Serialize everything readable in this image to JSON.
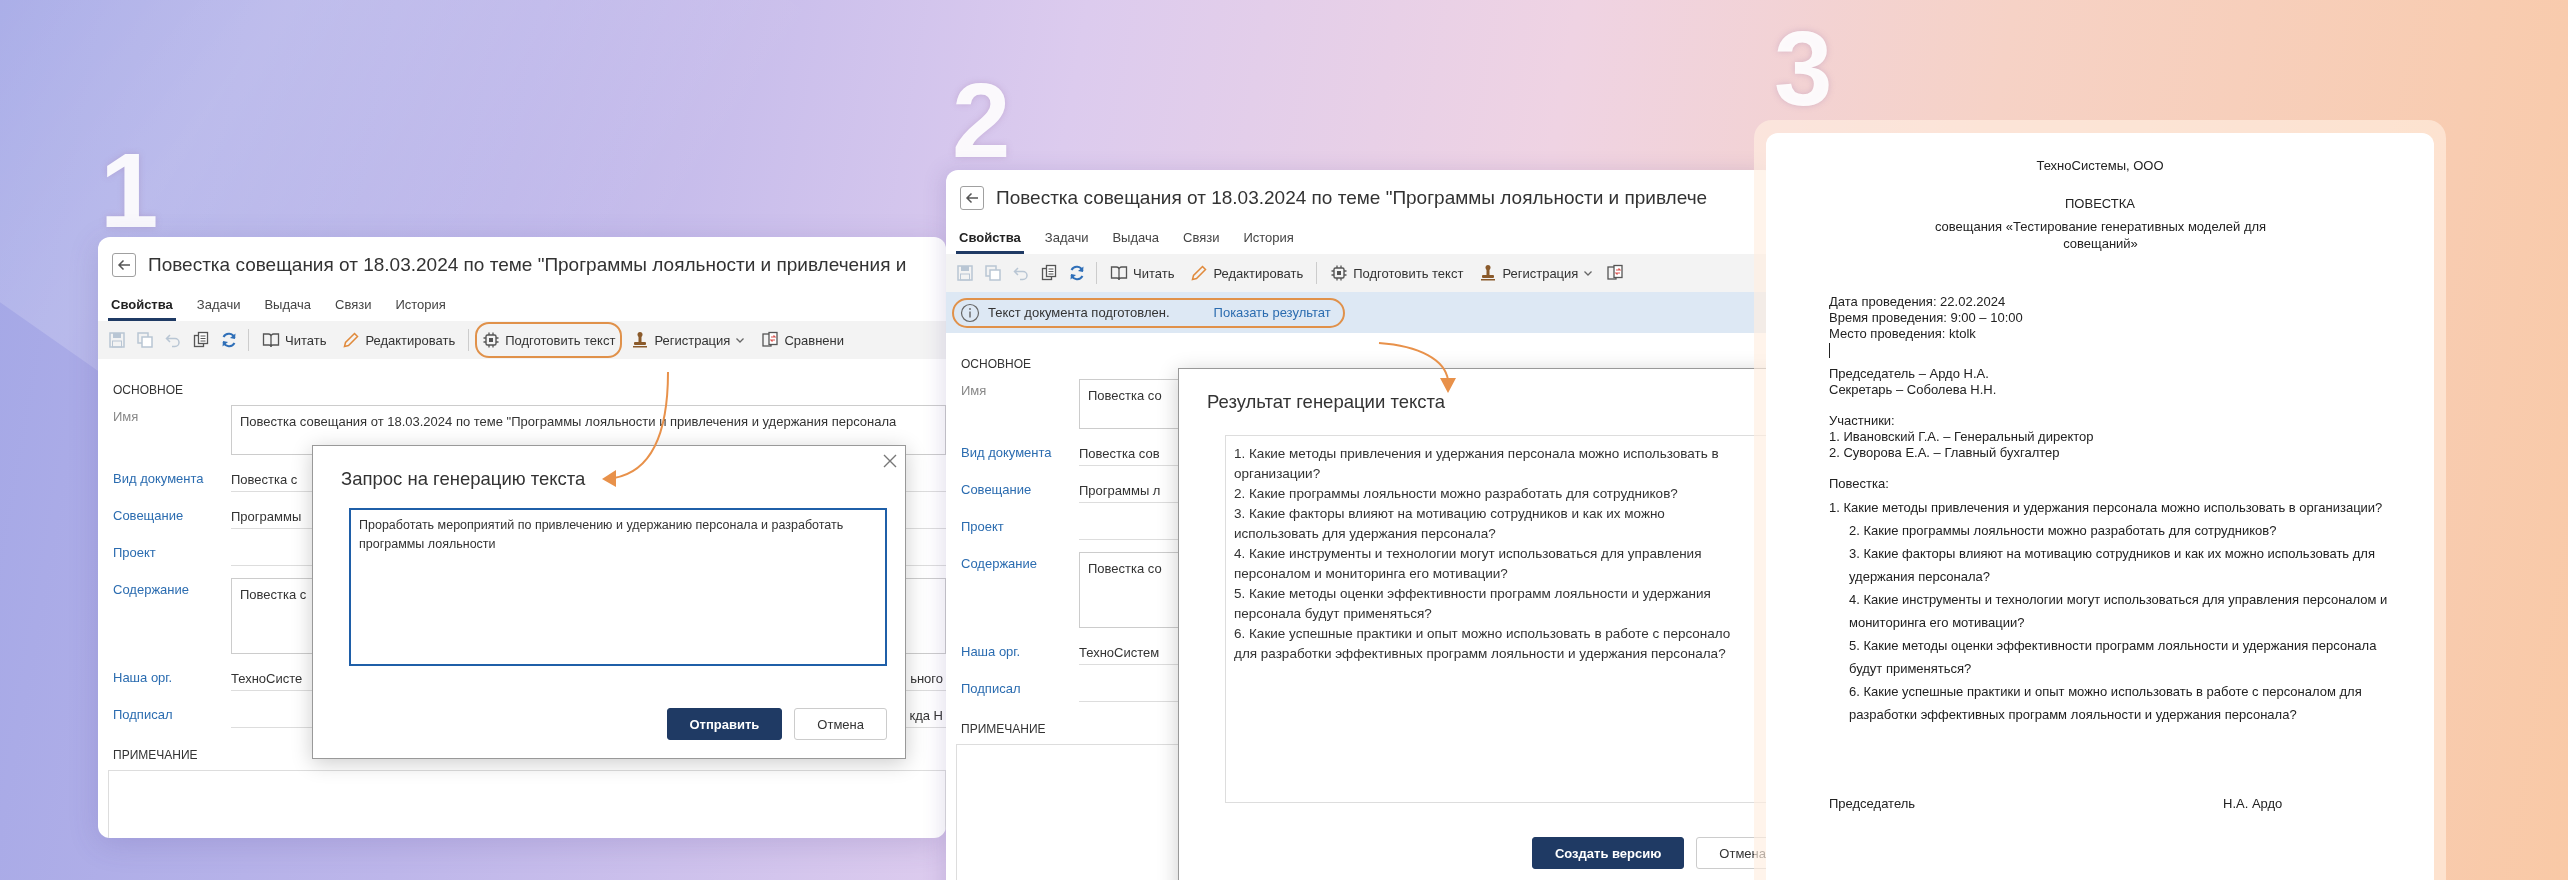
{
  "step_numbers": [
    "1",
    "2",
    "3"
  ],
  "panels": [
    {
      "title": "Повестка совещания от 18.03.2024 по теме \"Программы лояльности и привлечения и",
      "tabs": [
        {
          "label": "Свойства",
          "selected": true
        },
        {
          "label": "Задачи",
          "selected": false
        },
        {
          "label": "Выдача",
          "selected": false
        },
        {
          "label": "Связи",
          "selected": false
        },
        {
          "label": "История",
          "selected": false
        }
      ],
      "toolbar": [
        {
          "kind": "icon",
          "disabled": true
        },
        {
          "kind": "icon",
          "disabled": true
        },
        {
          "kind": "icon",
          "disabled": true
        },
        {
          "kind": "icon",
          "disabled": false
        },
        {
          "kind": "icon",
          "disabled": false
        },
        {
          "kind": "separator"
        },
        {
          "kind": "labeled",
          "label": "Читать",
          "highlighted": false
        },
        {
          "kind": "labeled",
          "label": "Редактировать",
          "highlighted": false
        },
        {
          "kind": "separator"
        },
        {
          "kind": "labeled",
          "label": "Подготовить текст",
          "highlighted": true
        },
        {
          "kind": "dropdown",
          "label": "Регистрация",
          "highlighted": false
        },
        {
          "kind": "labeled",
          "label": "Сравнени",
          "highlighted": false
        }
      ],
      "section_title": "ОСНОВНОЕ",
      "fields": [
        {
          "label": "Имя",
          "linked": false,
          "kind": "box",
          "value": "Повестка совещания от 18.03.2024 по теме \"Программы лояльности и привлечения и удержания персонала"
        },
        {
          "label": "Вид документа",
          "linked": true,
          "kind": "line",
          "value": "Повестка с"
        },
        {
          "label": "Совещание",
          "linked": true,
          "kind": "line",
          "value": "Программы"
        },
        {
          "label": "Проект",
          "linked": true,
          "kind": "line"
        },
        {
          "label": "Содержание",
          "linked": true,
          "kind": "area",
          "value": "Повестка с"
        },
        {
          "label": "Наша орг.",
          "linked": true,
          "kind": "line",
          "value": "ТехноСисте",
          "trailing": "ьного"
        },
        {
          "label": "Подписал",
          "linked": true,
          "kind": "line",
          "trailing": "кда Н"
        }
      ],
      "note_title": "ПРИМЕЧАНИЕ",
      "dialog": {
        "kind": "request",
        "title": "Запрос на генерацию текста",
        "text": "Проработать мероприятий по привлечению и удержанию персонала и разработать программы лояльности",
        "buttons": [
          {
            "label": "Отправить",
            "primary": true
          },
          {
            "label": "Отмена",
            "primary": false
          }
        ]
      }
    },
    {
      "title": "Повестка совещания от 18.03.2024 по теме \"Программы лояльности и привлече",
      "tabs": [
        {
          "label": "Свойства",
          "selected": true
        },
        {
          "label": "Задачи",
          "selected": false
        },
        {
          "label": "Выдача",
          "selected": false
        },
        {
          "label": "Связи",
          "selected": false
        },
        {
          "label": "История",
          "selected": false
        }
      ],
      "toolbar": [
        {
          "kind": "icon",
          "disabled": true
        },
        {
          "kind": "icon",
          "disabled": true
        },
        {
          "kind": "icon",
          "disabled": true
        },
        {
          "kind": "icon",
          "disabled": false
        },
        {
          "kind": "icon",
          "disabled": false
        },
        {
          "kind": "separator"
        },
        {
          "kind": "labeled",
          "label": "Читать",
          "highlighted": false
        },
        {
          "kind": "labeled",
          "label": "Редактировать",
          "highlighted": false
        },
        {
          "kind": "separator"
        },
        {
          "kind": "labeled",
          "label": "Подготовить текст",
          "highlighted": false
        },
        {
          "kind": "dropdown",
          "label": "Регистрация",
          "highlighted": false
        },
        {
          "kind": "icon",
          "disabled": false
        }
      ],
      "info_bar": {
        "message": "Текст документа подготовлен.",
        "link": "Показать результат",
        "highlighted": true
      },
      "section_title": "ОСНОВНОЕ",
      "fields": [
        {
          "label": "Имя",
          "linked": false,
          "kind": "box",
          "value": "Повестка со"
        },
        {
          "label": "Вид документа",
          "linked": true,
          "kind": "line",
          "value": "Повестка сов"
        },
        {
          "label": "Совещание",
          "linked": true,
          "kind": "line",
          "value": "Программы л"
        },
        {
          "label": "Проект",
          "linked": true,
          "kind": "line"
        },
        {
          "label": "Содержание",
          "linked": true,
          "kind": "area",
          "value": "Повестка со"
        },
        {
          "label": "Наша орг.",
          "linked": true,
          "kind": "line",
          "value": "ТехноСистем"
        },
        {
          "label": "Подписал",
          "linked": true,
          "kind": "line"
        }
      ],
      "note_title": "ПРИМЕЧАНИЕ",
      "dialog": {
        "kind": "result",
        "title": "Результат генерации текста",
        "text": "1. Какие методы привлечения и удержания персонала можно использовать в\nорганизации?\n2. Какие программы лояльности можно разработать для сотрудников?\n3. Какие факторы влияют на мотивацию сотрудников и как их можно\nиспользовать для удержания персонала?\n4. Какие инструменты и технологии могут использоваться для управления\nперсоналом и мониторинга его мотивации?\n5. Какие методы оценки эффективности программ лояльности и удержания\nперсонала будут применяться?\n6. Какие успешные практики и опыт можно использовать в работе с персонало\nдля разработки эффективных программ лояльности и удержания персонала?",
        "buttons": [
          {
            "label": "Создать версию",
            "primary": true
          },
          {
            "label": "Отмена",
            "primary": false
          }
        ]
      }
    }
  ],
  "document": {
    "company": "ТехноСистемы, ООО",
    "heading": "ПОВЕСТКА",
    "subheading": "совещания «Тестирование генеративных моделей для совещаний»",
    "details": [
      "Дата проведения: 22.02.2024",
      "Время проведения: 9:00 – 10:00",
      "Место проведения: ktolk"
    ],
    "roles": [
      "Председатель – Ардо Н.А.",
      "Секретарь – Соболева Н.Н."
    ],
    "participants_title": "Участники:",
    "participants": [
      "1. Ивановский Г.А. – Генеральный директор",
      "2. Суворова Е.А. – Главный бухгалтер"
    ],
    "agenda_title": "Повестка:",
    "agenda": [
      "1. Какие методы привлечения и удержания персонала можно использовать в организации?",
      "2. Какие программы лояльности можно разработать для сотрудников?",
      "3. Какие факторы влияют на мотивацию сотрудников и как их можно использовать для удержания персонала?",
      "4. Какие инструменты и технологии могут использоваться для управления персоналом и мониторинга его мотивации?",
      "5. Какие методы оценки эффективности программ лояльности и удержания персонала будут применяться?",
      "6. Какие успешные практики и опыт можно использовать в работе с персоналом для разработки эффективных программ лояльности и удержания персонала?"
    ],
    "signature": {
      "role": "Председатель",
      "name": "Н.А. Ардо"
    }
  }
}
